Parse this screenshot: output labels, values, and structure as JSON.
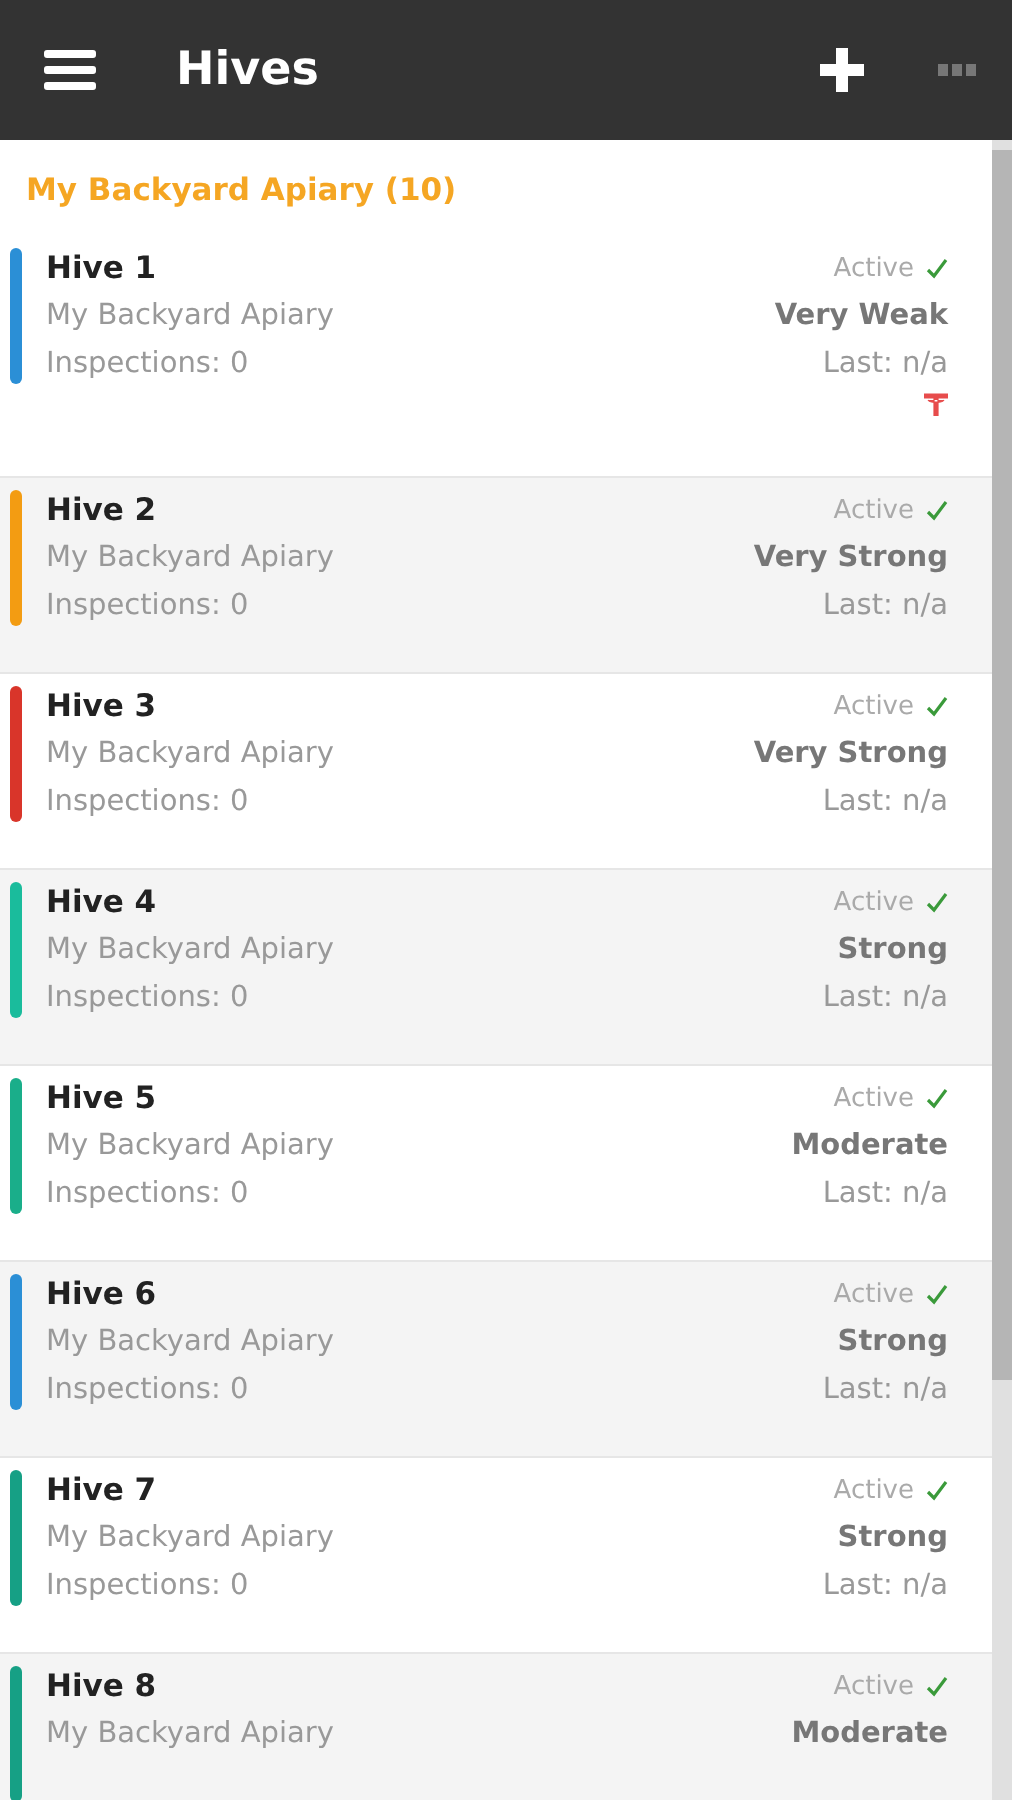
{
  "app_bar": {
    "title": "Hives"
  },
  "group": {
    "title": "My Backyard Apiary (10)"
  },
  "hives": [
    {
      "name": "Hive 1",
      "apiary": "My Backyard Apiary",
      "inspections": "Inspections: 0",
      "status": "Active",
      "strength": "Very Weak",
      "last": "Last: n/a",
      "color": "#2b8fd6",
      "flagged": true
    },
    {
      "name": "Hive 2",
      "apiary": "My Backyard Apiary",
      "inspections": "Inspections: 0",
      "status": "Active",
      "strength": "Very Strong",
      "last": "Last: n/a",
      "color": "#f39c12",
      "flagged": false
    },
    {
      "name": "Hive 3",
      "apiary": "My Backyard Apiary",
      "inspections": "Inspections: 0",
      "status": "Active",
      "strength": "Very Strong",
      "last": "Last: n/a",
      "color": "#d9352a",
      "flagged": false
    },
    {
      "name": "Hive 4",
      "apiary": "My Backyard Apiary",
      "inspections": "Inspections: 0",
      "status": "Active",
      "strength": "Strong",
      "last": "Last: n/a",
      "color": "#1abc9c",
      "flagged": false
    },
    {
      "name": "Hive 5",
      "apiary": "My Backyard Apiary",
      "inspections": "Inspections: 0",
      "status": "Active",
      "strength": "Moderate",
      "last": "Last: n/a",
      "color": "#1aae8a",
      "flagged": false
    },
    {
      "name": "Hive 6",
      "apiary": "My Backyard Apiary",
      "inspections": "Inspections: 0",
      "status": "Active",
      "strength": "Strong",
      "last": "Last: n/a",
      "color": "#2b8fd6",
      "flagged": false
    },
    {
      "name": "Hive 7",
      "apiary": "My Backyard Apiary",
      "inspections": "Inspections: 0",
      "status": "Active",
      "strength": "Strong",
      "last": "Last: n/a",
      "color": "#16a085",
      "flagged": false
    },
    {
      "name": "Hive 8",
      "apiary": "My Backyard Apiary",
      "status": "Active",
      "strength": "Moderate",
      "color": "#16a085",
      "flagged": false
    }
  ]
}
